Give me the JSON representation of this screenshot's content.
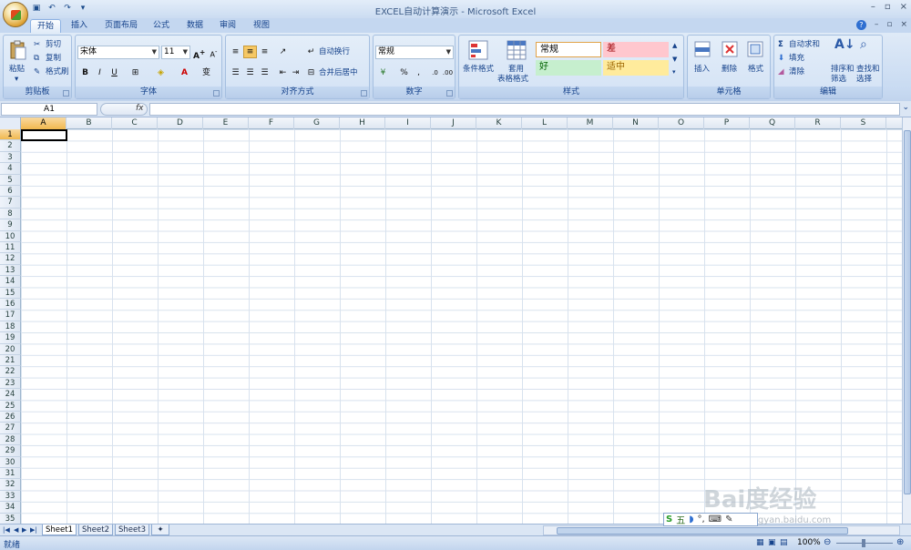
{
  "window": {
    "title": "EXCEL自动计算演示 - Microsoft Excel",
    "controls": [
      "–",
      "▫",
      "×"
    ]
  },
  "qat": {
    "icons": [
      "save-icon",
      "undo-icon",
      "redo-icon",
      "customize-icon"
    ]
  },
  "tabs": [
    {
      "label": "开始",
      "active": true
    },
    {
      "label": "插入"
    },
    {
      "label": "页面布局"
    },
    {
      "label": "公式"
    },
    {
      "label": "数据"
    },
    {
      "label": "审阅"
    },
    {
      "label": "视图"
    }
  ],
  "ribbon": {
    "clipboard": {
      "label": "剪贴板",
      "paste": "粘贴",
      "cut": "剪切",
      "copy": "复制",
      "format_painter": "格式刷"
    },
    "font": {
      "label": "字体",
      "font_name": "宋体",
      "font_size": "11",
      "bold": "B",
      "italic": "I",
      "underline": "U",
      "phonetic": "变"
    },
    "alignment": {
      "label": "对齐方式",
      "wrap": "自动换行",
      "merge": "合并后居中"
    },
    "number": {
      "label": "数字",
      "format": "常规",
      "percent": "%"
    },
    "styles": {
      "label": "样式",
      "conditional": "条件格式",
      "table": [
        "套用",
        "表格格式"
      ],
      "cells": [
        {
          "label": "常规",
          "bg": "#ffffff",
          "color": "#000000"
        },
        {
          "label": "差",
          "bg": "#ffc7ce",
          "color": "#9c0006"
        },
        {
          "label": "好",
          "bg": "#c6efce",
          "color": "#006100"
        },
        {
          "label": "适中",
          "bg": "#ffeb9c",
          "color": "#9c6500"
        }
      ]
    },
    "cells": {
      "label": "单元格",
      "insert": "插入",
      "delete": "删除",
      "format": "格式"
    },
    "editing": {
      "label": "编辑",
      "autosum": "自动求和",
      "fill": "填充",
      "clear": "清除",
      "sort": [
        "排序和",
        "筛选"
      ],
      "find": [
        "查找和",
        "选择"
      ]
    }
  },
  "formula_bar": {
    "name_box": "A1",
    "fx": "fx",
    "value": ""
  },
  "grid": {
    "columns": [
      "A",
      "B",
      "C",
      "D",
      "E",
      "F",
      "G",
      "H",
      "I",
      "J",
      "K",
      "L",
      "M",
      "N",
      "O",
      "P",
      "Q",
      "R",
      "S"
    ],
    "rows": [
      "1",
      "2",
      "3",
      "4",
      "5",
      "6",
      "7",
      "8",
      "9",
      "10",
      "11",
      "12",
      "13",
      "14",
      "15",
      "16",
      "17",
      "18",
      "19",
      "20",
      "21",
      "22",
      "23",
      "24",
      "25",
      "26",
      "27",
      "28",
      "29",
      "30",
      "31",
      "32",
      "33",
      "34",
      "35"
    ],
    "selected_col": "A",
    "selected_row": "1"
  },
  "sheets": [
    {
      "label": "Sheet1",
      "active": true
    },
    {
      "label": "Sheet2"
    },
    {
      "label": "Sheet3"
    }
  ],
  "status": {
    "ready": "就绪",
    "zoom": "100%"
  },
  "ime": {
    "label": "五"
  },
  "watermark": {
    "text": "Bai度经验",
    "url": "jingyan.baidu.com"
  }
}
